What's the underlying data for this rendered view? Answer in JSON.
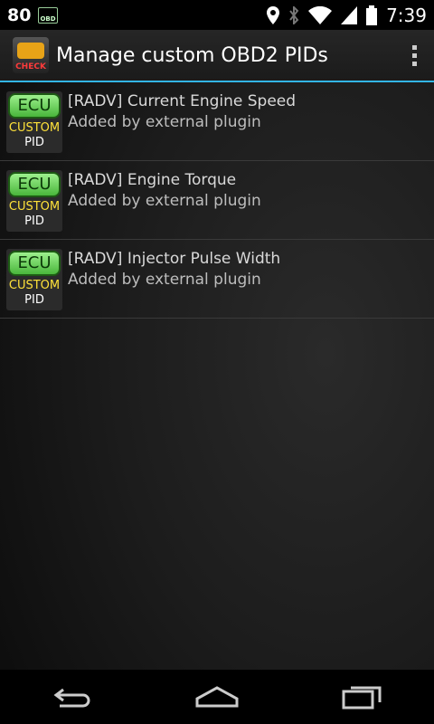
{
  "status_bar": {
    "notification_count": "80",
    "notification_icon_label": "OBD",
    "time": "7:39",
    "icons": [
      "location-icon",
      "bluetooth-icon",
      "wifi-icon",
      "signal-icon",
      "battery-icon"
    ]
  },
  "action_bar": {
    "title": "Manage custom OBD2 PIDs",
    "app_icon_label": "CHECK",
    "overflow_icon": "overflow-menu-icon"
  },
  "pid_icon": {
    "ecu": "ECU",
    "custom": "CUSTOM",
    "pid": "PID"
  },
  "items": [
    {
      "title": "[RADV] Current Engine Speed",
      "subtitle": "Added by external plugin"
    },
    {
      "title": "[RADV] Engine Torque",
      "subtitle": "Added by external plugin"
    },
    {
      "title": "[RADV] Injector Pulse Width",
      "subtitle": "Added by external plugin"
    }
  ],
  "nav_bar": {
    "buttons": [
      "back-icon",
      "home-icon",
      "recents-icon"
    ]
  },
  "colors": {
    "accent": "#33b5e5",
    "ecu_green": "#49b63b",
    "custom_yellow": "#ffe23a"
  }
}
